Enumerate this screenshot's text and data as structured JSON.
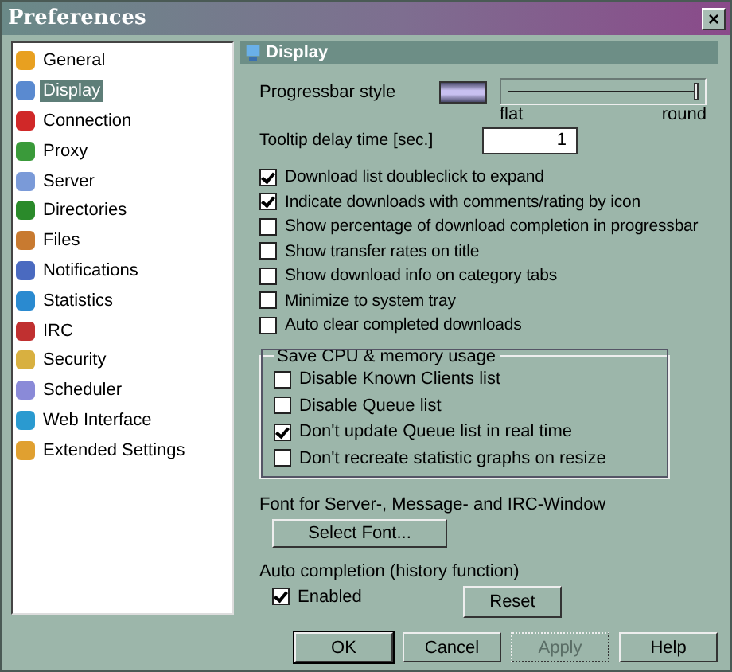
{
  "window": {
    "title": "Preferences",
    "close": "×"
  },
  "sidebar": {
    "items": [
      {
        "label": "General",
        "selected": false
      },
      {
        "label": "Display",
        "selected": true
      },
      {
        "label": "Connection",
        "selected": false
      },
      {
        "label": "Proxy",
        "selected": false
      },
      {
        "label": "Server",
        "selected": false
      },
      {
        "label": "Directories",
        "selected": false
      },
      {
        "label": "Files",
        "selected": false
      },
      {
        "label": "Notifications",
        "selected": false
      },
      {
        "label": "Statistics",
        "selected": false
      },
      {
        "label": "IRC",
        "selected": false
      },
      {
        "label": "Security",
        "selected": false
      },
      {
        "label": "Scheduler",
        "selected": false
      },
      {
        "label": "Web Interface",
        "selected": false
      },
      {
        "label": "Extended Settings",
        "selected": false
      }
    ]
  },
  "panel": {
    "title": "Display",
    "progressbar_style": {
      "label": "Progressbar style",
      "level": 1,
      "min_label": "flat",
      "max_label": "round"
    },
    "tooltip_delay": {
      "label": "Tooltip delay time [sec.]",
      "value": "1"
    },
    "options": [
      {
        "label": "Download list doubleclick to expand",
        "checked": true
      },
      {
        "label": "Indicate downloads with comments/rating by icon",
        "checked": true
      },
      {
        "label": "Show percentage of download completion in progressbar",
        "checked": false
      },
      {
        "label": "Show transfer rates on title",
        "checked": false
      },
      {
        "label": "Show download info on category tabs",
        "checked": false
      },
      {
        "label": "Minimize to system tray",
        "checked": false
      },
      {
        "label": "Auto clear completed downloads",
        "checked": false
      }
    ],
    "cpu_group": {
      "title": "Save CPU & memory usage",
      "options": [
        {
          "label": "Disable Known Clients list",
          "checked": false
        },
        {
          "label": "Disable Queue list",
          "checked": false
        },
        {
          "label": "Don't update Queue list in real time",
          "checked": true
        },
        {
          "label": "Don't recreate statistic graphs on resize",
          "checked": false
        }
      ]
    },
    "font": {
      "label": "Font for Server-, Message- and IRC-Window",
      "button": "Select Font..."
    },
    "auto_completion": {
      "label": "Auto completion (history function)",
      "enabled_label": "Enabled",
      "enabled": true,
      "reset": "Reset"
    }
  },
  "buttons": [
    {
      "label": "OK",
      "default": true,
      "disabled": false
    },
    {
      "label": "Cancel",
      "default": false,
      "disabled": false
    },
    {
      "label": "Apply",
      "default": false,
      "disabled": true
    },
    {
      "label": "Help",
      "default": false,
      "disabled": false
    }
  ]
}
